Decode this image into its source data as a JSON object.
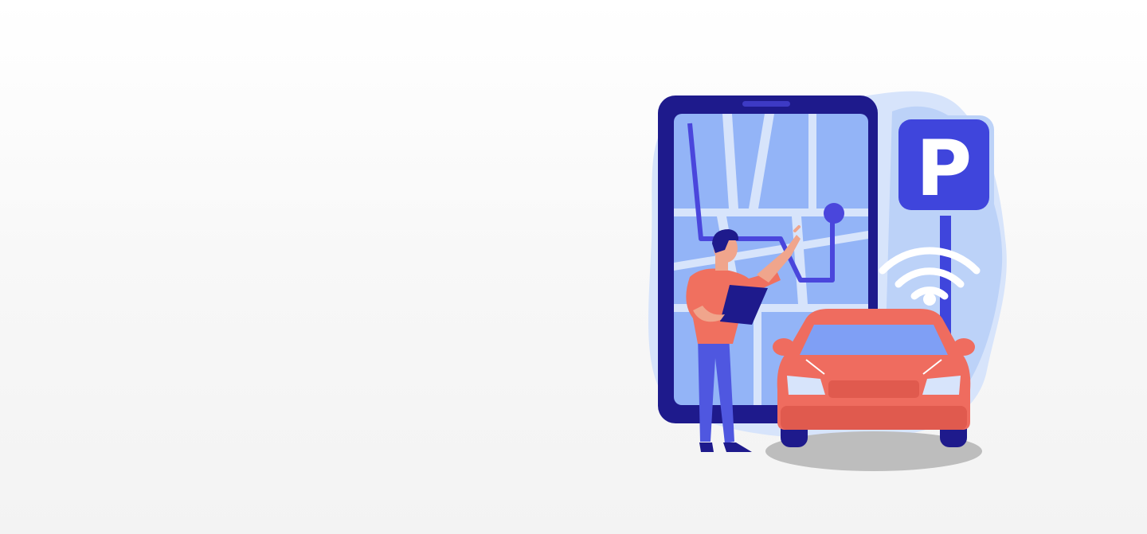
{
  "hero": {
    "illustration": {
      "theme": "smart-parking",
      "parking_sign_letter": "P",
      "icons": [
        "phone-map-icon",
        "parking-sign-icon",
        "wifi-signal-icon",
        "car-icon",
        "person-icon",
        "tablet-icon",
        "location-pin-icon"
      ]
    },
    "colors": {
      "background": "#f7f7f7",
      "phone_frame": "#1e1a8c",
      "map_screen": "#93b4f7",
      "map_road": "#d7e4fb",
      "route": "#4a46dc",
      "sign": "#3f45dc",
      "car": "#ef6c5f",
      "car_dark": "#e05a4e",
      "shirt": "#f0705f",
      "pants": "#4f57e0",
      "blob": "#bcd2f8",
      "shadow": "#bdbdbd"
    }
  }
}
